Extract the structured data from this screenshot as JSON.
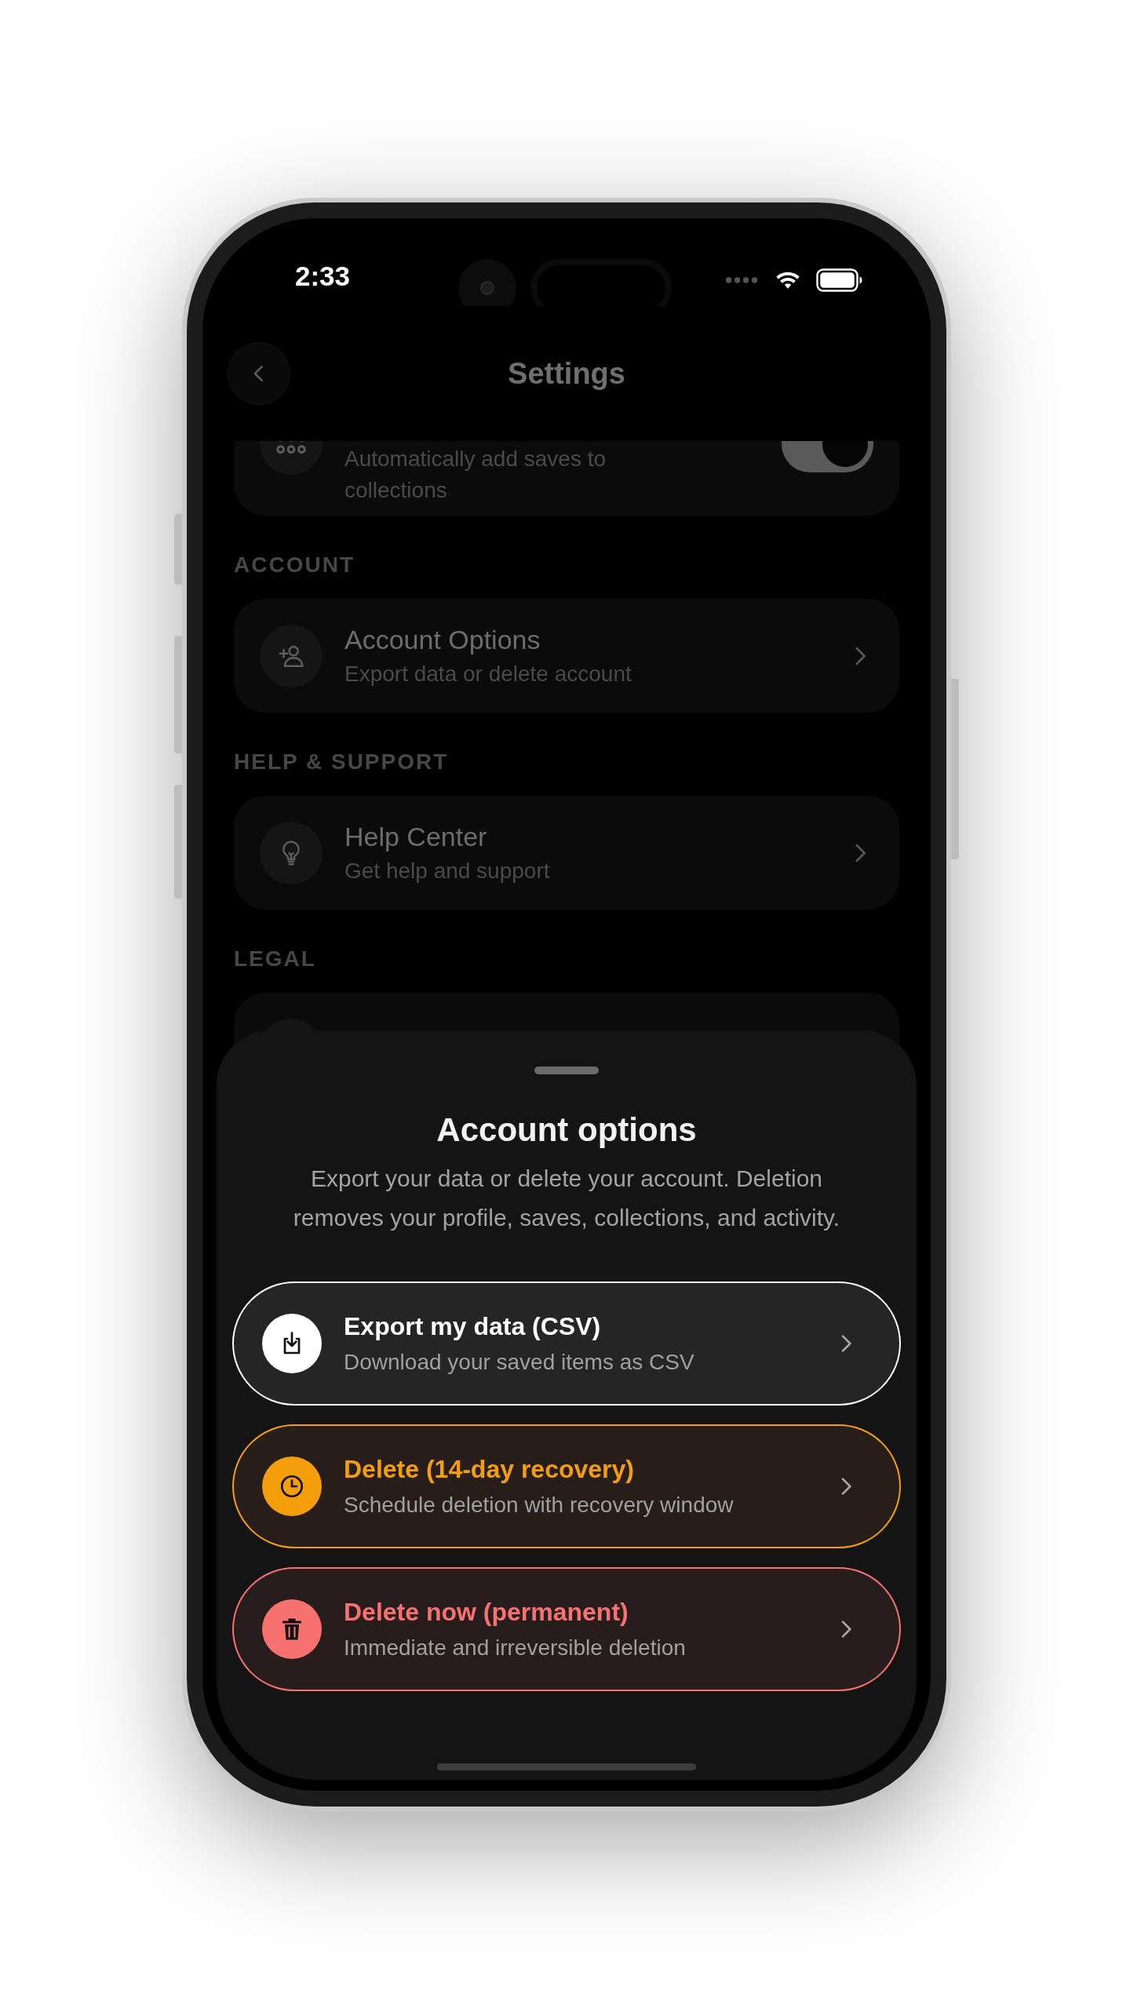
{
  "status_bar": {
    "time": "2:33"
  },
  "header": {
    "title": "Settings"
  },
  "partial_item": {
    "kind": "collections",
    "subtitle": "Automatically add saves to collections",
    "on": true
  },
  "sections": [
    {
      "heading": "ACCOUNT",
      "items": [
        {
          "kind": "account",
          "title": "Account Options",
          "subtitle": "Export data or delete account"
        }
      ]
    },
    {
      "heading": "HELP & SUPPORT",
      "items": [
        {
          "kind": "help",
          "title": "Help Center",
          "subtitle": "Get help and support"
        }
      ]
    },
    {
      "heading": "LEGAL",
      "items": [
        {
          "kind": "legal"
        }
      ]
    }
  ],
  "sheet": {
    "title": "Account options",
    "description": "Export your data or delete your account. Deletion removes your profile, saves, collections, and activity.",
    "options": [
      {
        "kind": "export",
        "color": "#ffffff",
        "title": "Export my data (CSV)",
        "subtitle": "Download your saved items as CSV"
      },
      {
        "kind": "schedule",
        "color": "#f59e0b",
        "title": "Delete (14-day recovery)",
        "subtitle": "Schedule deletion with recovery window"
      },
      {
        "kind": "delete",
        "color": "#f87171",
        "title": "Delete now (permanent)",
        "subtitle": "Immediate and irreversible deletion"
      }
    ]
  }
}
